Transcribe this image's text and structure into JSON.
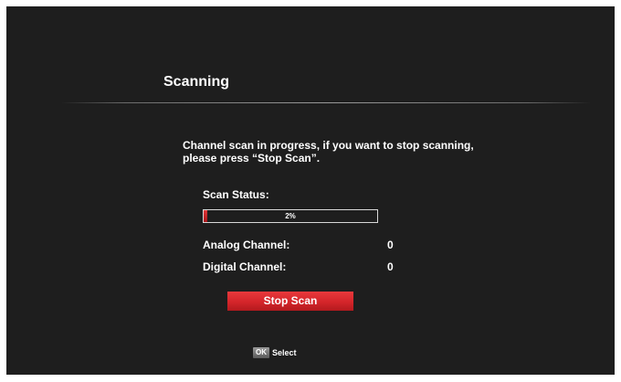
{
  "dialog": {
    "title": "Scanning",
    "message": "Channel scan in progress, if you want to stop scanning, please press “Stop Scan”."
  },
  "scan": {
    "status_label": "Scan Status:",
    "progress_percent": 2,
    "progress_text": "2%"
  },
  "channels": {
    "analog_label": "Analog Channel:",
    "analog_count": "0",
    "digital_label": "Digital Channel:",
    "digital_count": "0"
  },
  "actions": {
    "stop_label": "Stop Scan"
  },
  "footer": {
    "ok_key": "OK",
    "select_label": "Select"
  },
  "colors": {
    "background": "#1e1e1e",
    "accent_red": "#d4252a",
    "text": "#ffffff"
  }
}
